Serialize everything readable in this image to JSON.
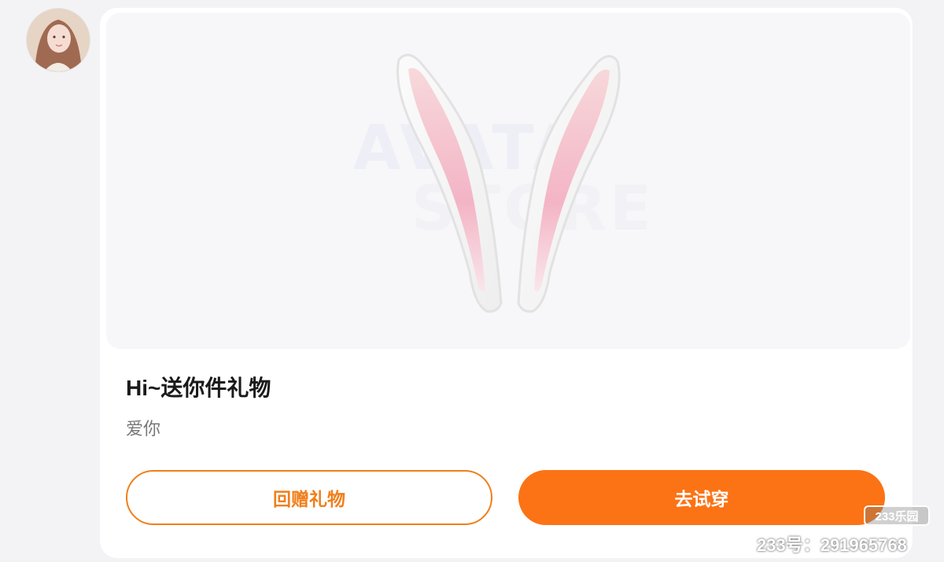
{
  "gift": {
    "title": "Hi~送你件礼物",
    "message": "爱你",
    "watermark_line1": "AVATA",
    "watermark_line2": "STORE"
  },
  "buttons": {
    "return_gift": "回赠礼物",
    "try_on": "去试穿"
  },
  "overlay": {
    "logo": "233乐园",
    "id_text": "233号：291965768"
  },
  "colors": {
    "accent": "#fb7315",
    "accent_border": "#f07f1b",
    "card_bg": "#ffffff",
    "preview_bg": "#f7f7fa"
  },
  "icons": {
    "avatar": "user-avatar",
    "item": "bunny-ears"
  }
}
